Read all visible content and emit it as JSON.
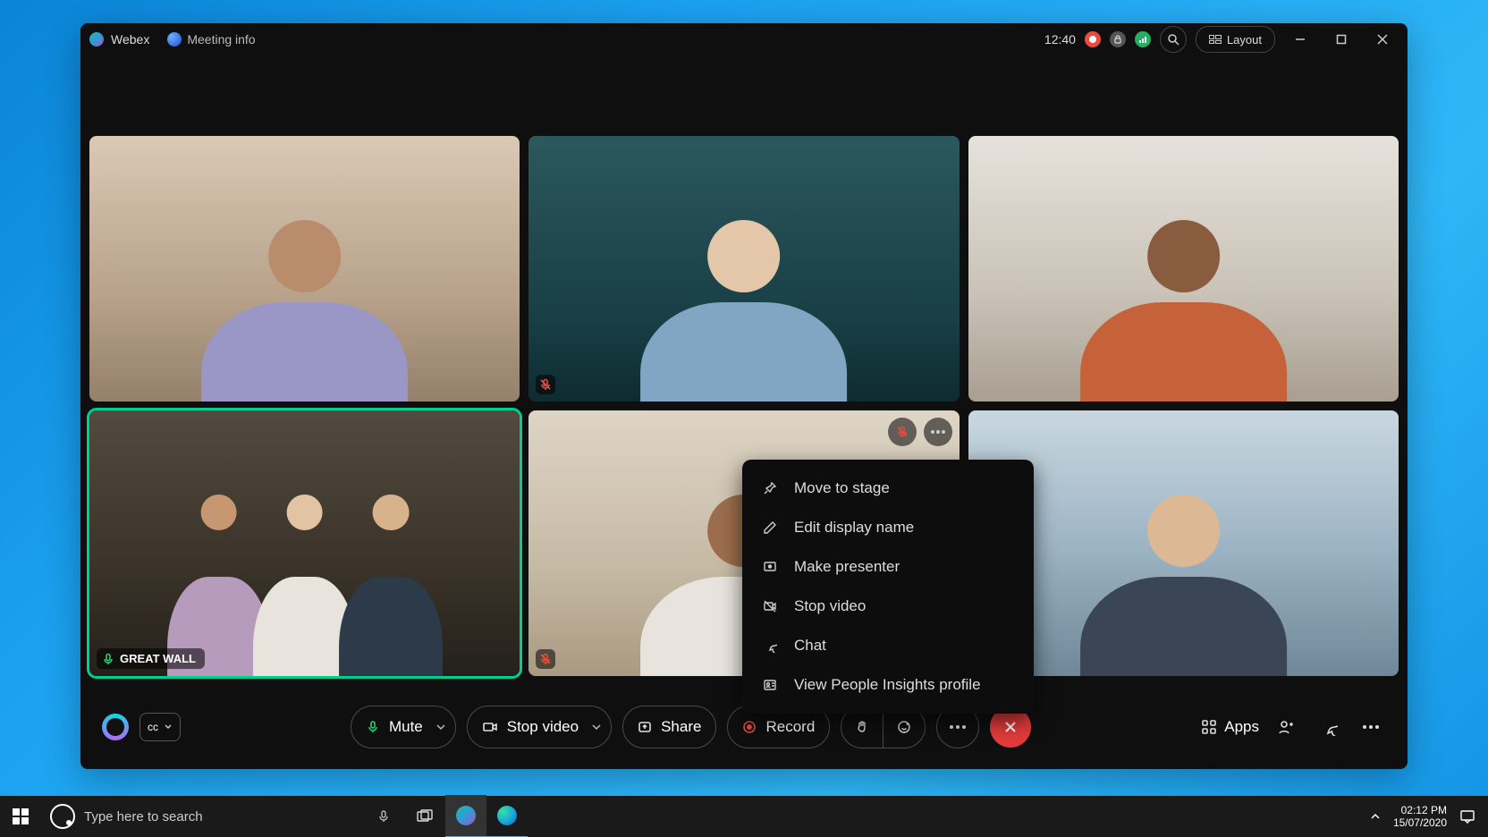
{
  "app": {
    "name": "Webex",
    "meeting_info_label": "Meeting info",
    "time": "12:40",
    "layout_button_label": "Layout"
  },
  "tiles": {
    "active_label": "GREAT WALL"
  },
  "context_menu": {
    "items": [
      "Move to stage",
      "Edit display name",
      "Make presenter",
      "Stop video",
      "Chat",
      "View People Insights profile"
    ]
  },
  "controls": {
    "mute": "Mute",
    "stop_video": "Stop video",
    "share": "Share",
    "record": "Record",
    "apps": "Apps",
    "cc": "cc"
  },
  "taskbar": {
    "search_placeholder": "Type here to search",
    "time": "02:12 PM",
    "date": "15/07/2020"
  }
}
